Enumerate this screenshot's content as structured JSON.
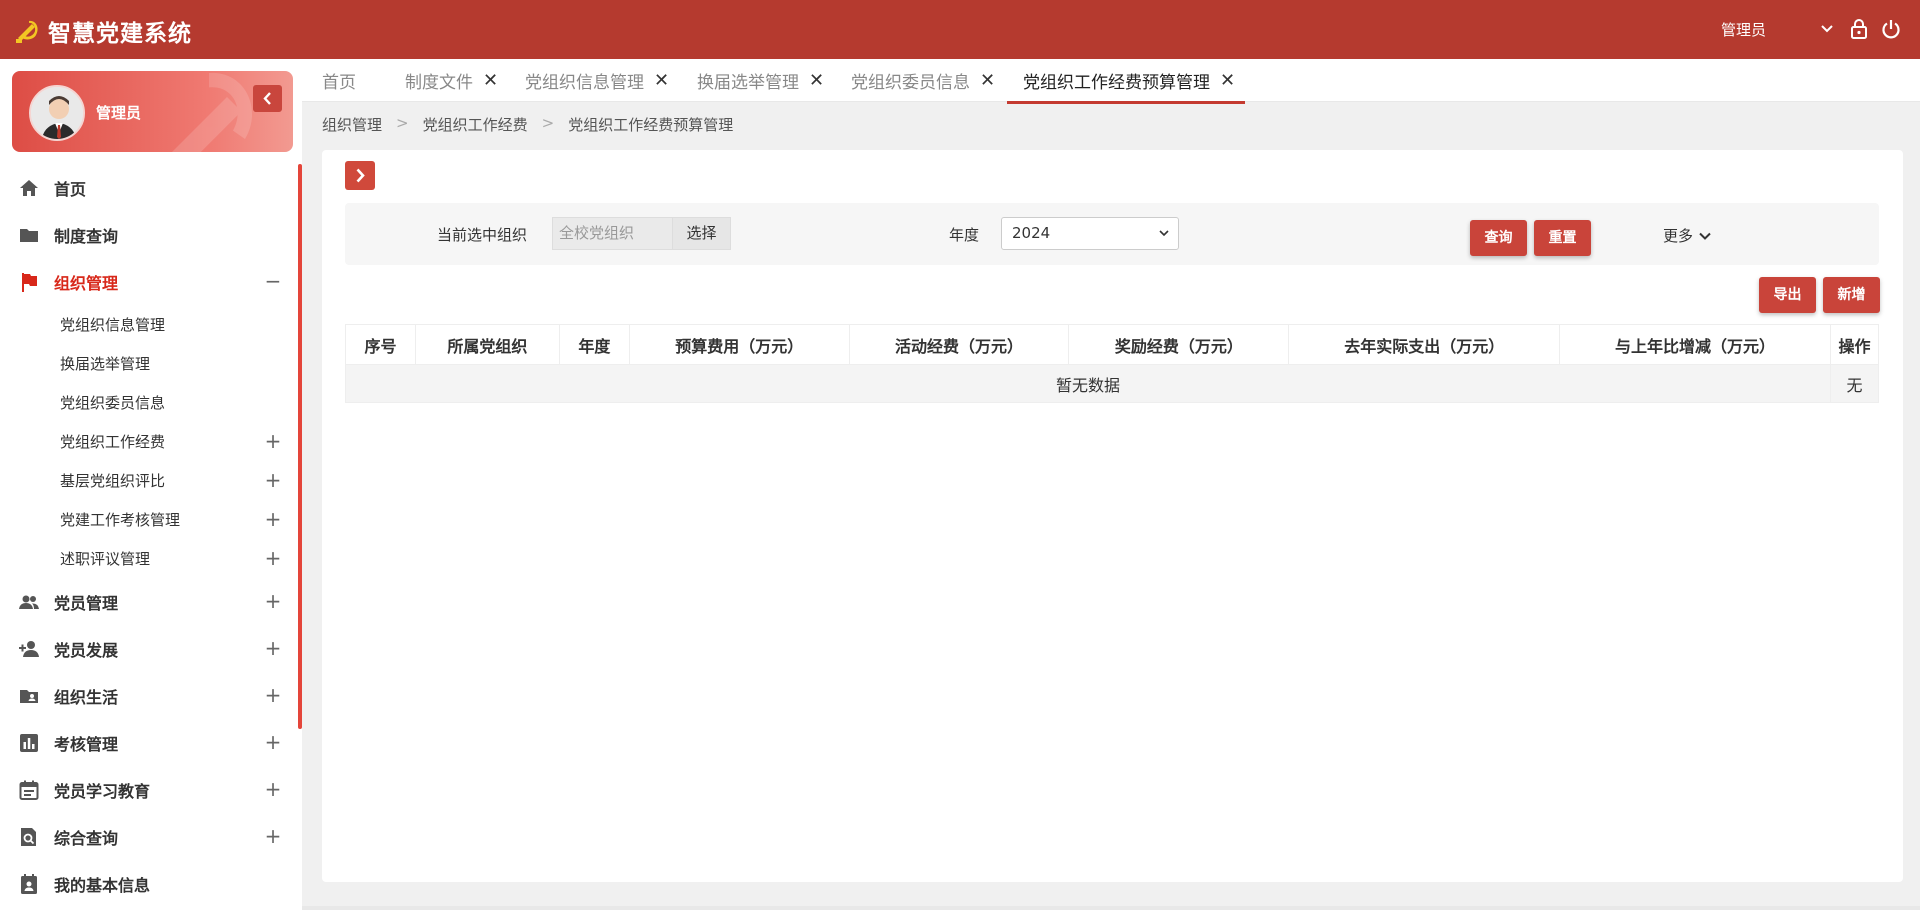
{
  "app": {
    "title": "智慧党建系统",
    "logo_icon": "party-emblem-icon",
    "brand_color": "#b53a2f"
  },
  "header": {
    "user": "管理员",
    "icons": [
      "chevron-down-icon",
      "lock-icon",
      "power-icon"
    ]
  },
  "profile": {
    "name": "管理员",
    "collapse_icon": "chevron-left-icon"
  },
  "sidebar": {
    "items": [
      {
        "label": "首页",
        "icon": "home-icon"
      },
      {
        "label": "制度查询",
        "icon": "folder-icon"
      },
      {
        "label": "组织管理",
        "icon": "flag-icon",
        "toggle": "−",
        "active": true,
        "children": [
          {
            "label": "党组织信息管理",
            "toggle": ""
          },
          {
            "label": "换届选举管理",
            "toggle": ""
          },
          {
            "label": "党组织委员信息",
            "toggle": ""
          },
          {
            "label": "党组织工作经费",
            "toggle": "+"
          },
          {
            "label": "基层党组织评比",
            "toggle": "+"
          },
          {
            "label": "党建工作考核管理",
            "toggle": "+"
          },
          {
            "label": "述职评议管理",
            "toggle": "+"
          }
        ]
      },
      {
        "label": "党员管理",
        "icon": "people-icon",
        "toggle": "+"
      },
      {
        "label": "党员发展",
        "icon": "add-person-icon",
        "toggle": "+"
      },
      {
        "label": "组织生活",
        "icon": "folder-person-icon",
        "toggle": "+"
      },
      {
        "label": "考核管理",
        "icon": "bar-chart-icon",
        "toggle": "+"
      },
      {
        "label": "党员学习教育",
        "icon": "calendar-icon",
        "toggle": "+"
      },
      {
        "label": "综合查询",
        "icon": "search-doc-icon",
        "toggle": "+"
      },
      {
        "label": "我的基本信息",
        "icon": "id-card-icon",
        "toggle": ""
      }
    ]
  },
  "tabs": [
    {
      "label": "首页",
      "closable": false
    },
    {
      "label": "制度文件",
      "closable": true,
      "close": "✕"
    },
    {
      "label": "党组织信息管理",
      "closable": true,
      "close": "✕"
    },
    {
      "label": "换届选举管理",
      "closable": true,
      "close": "✕"
    },
    {
      "label": "党组织委员信息",
      "closable": true,
      "close": "✕"
    },
    {
      "label": "党组织工作经费预算管理",
      "closable": true,
      "close": "✕",
      "active": true
    }
  ],
  "breadcrumb": {
    "items": [
      "组织管理",
      "党组织工作经费",
      "党组织工作经费预算管理"
    ],
    "separator": ">"
  },
  "search": {
    "org_label": "当前选中组织",
    "org_placeholder": "全校党组织",
    "select_button": "选择",
    "year_label": "年度",
    "year_value": "2024",
    "more_label": "更多",
    "query_button": "查询",
    "reset_button": "重置"
  },
  "actions": {
    "export_button": "导出",
    "add_button": "新增"
  },
  "table": {
    "columns": [
      "序号",
      "所属党组织",
      "年度",
      "预算费用（万元）",
      "活动经费（万元）",
      "奖励经费（万元）",
      "去年实际支出（万元）",
      "与上年比增减（万元）",
      "操作"
    ],
    "empty_text": "暂无数据",
    "empty_action": "无"
  }
}
